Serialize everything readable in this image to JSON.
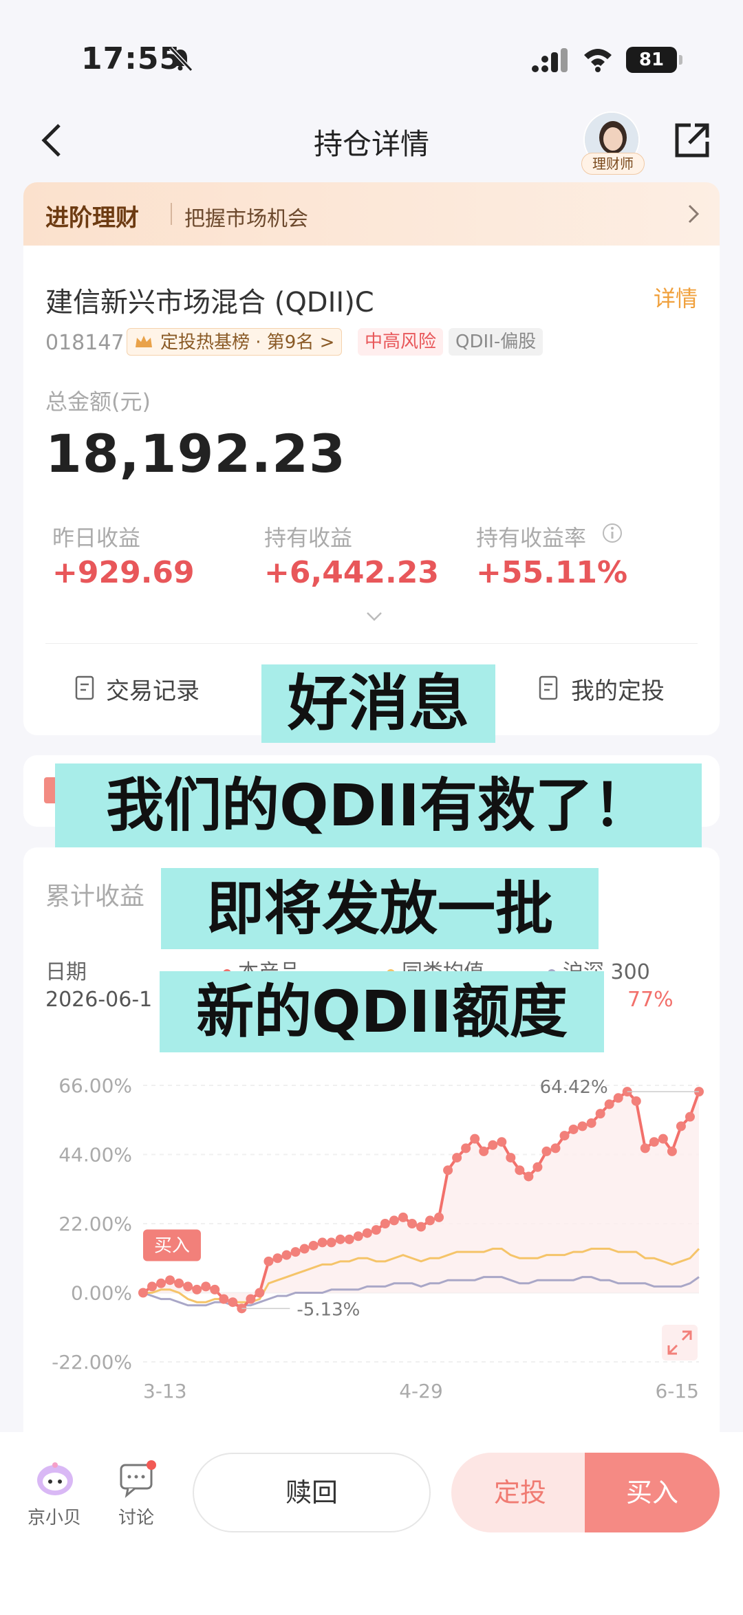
{
  "status": {
    "time": "17:55",
    "battery": "81"
  },
  "nav": {
    "title": "持仓详情",
    "advisor_badge": "理财师"
  },
  "banner": {
    "title": "进阶理财",
    "subtitle": "把握市场机会"
  },
  "fund": {
    "name": "建信新兴市场混合 (QDII)C",
    "detail": "详情",
    "code": "018147",
    "tags": [
      "定投热基榜 · 第9名 >",
      "中高风险",
      "QDII-偏股"
    ],
    "total_label": "总金额(元)",
    "total": "18,192.23",
    "stats": [
      {
        "label": "昨日收益",
        "value": "+929.69"
      },
      {
        "label": "持有收益",
        "value": "+6,442.23"
      },
      {
        "label": "持有收益率",
        "value": "+55.11%"
      }
    ],
    "actions": [
      "交易记录",
      "我的定投"
    ]
  },
  "chart_section": {
    "title": "累计收益",
    "date_label": "日期",
    "date_value": "2026-06-1",
    "legend": [
      "本产品",
      "同类均值",
      "沪深 300"
    ],
    "visible_value": "77%",
    "buy_marker": "买入"
  },
  "chart_data": {
    "type": "line",
    "x_ticks": [
      "3-13",
      "4-29",
      "6-15"
    ],
    "y_ticks": [
      "66.00%",
      "44.00%",
      "22.00%",
      "0.00%",
      "-22.00%"
    ],
    "ylim": [
      -22,
      66
    ],
    "annotations": [
      "64.42%",
      "-5.13%"
    ],
    "series": [
      {
        "name": "本产品",
        "color": "#f2706b",
        "values": [
          0,
          2,
          3,
          4,
          3,
          2,
          1,
          2,
          1,
          -2,
          -3,
          -5,
          -2,
          0,
          10,
          11,
          12,
          13,
          14,
          15,
          16,
          16,
          17,
          17,
          18,
          19,
          20,
          22,
          23,
          24,
          22,
          21,
          23,
          24,
          39,
          43,
          46,
          49,
          45,
          47,
          48,
          43,
          39,
          37,
          40,
          45,
          46,
          50,
          52,
          53,
          54,
          57,
          60,
          62,
          64,
          61,
          46,
          48,
          49,
          45,
          53,
          56,
          64
        ]
      },
      {
        "name": "同类均值",
        "color": "#f5c469",
        "values": [
          0,
          0,
          1,
          1,
          0,
          -2,
          -3,
          -3,
          -2,
          -2,
          -3,
          -3,
          -3,
          -2,
          3,
          4,
          5,
          6,
          7,
          8,
          9,
          9,
          10,
          10,
          11,
          11,
          10,
          10,
          11,
          12,
          11,
          10,
          11,
          11,
          12,
          13,
          13,
          13,
          13,
          14,
          14,
          12,
          11,
          11,
          11,
          12,
          12,
          12,
          13,
          13,
          14,
          14,
          14,
          13,
          13,
          13,
          11,
          11,
          10,
          9,
          10,
          11,
          14
        ]
      },
      {
        "name": "沪深 300",
        "color": "#a9a7c7",
        "values": [
          0,
          -1,
          -2,
          -2,
          -3,
          -4,
          -4,
          -4,
          -3,
          -3,
          -4,
          -4,
          -4,
          -3,
          -2,
          -1,
          -1,
          0,
          0,
          0,
          0,
          1,
          1,
          1,
          1,
          2,
          2,
          2,
          3,
          3,
          3,
          2,
          3,
          3,
          4,
          4,
          4,
          4,
          5,
          5,
          5,
          4,
          3,
          3,
          4,
          4,
          4,
          4,
          4,
          5,
          5,
          4,
          4,
          3,
          3,
          3,
          3,
          2,
          2,
          2,
          2,
          3,
          5
        ]
      }
    ]
  },
  "captions": [
    "好消息",
    "我们的QDII有救了！",
    "即将发放一批",
    "新的QDII额度"
  ],
  "bottom": {
    "items": [
      "京小贝",
      "讨论"
    ],
    "redeem": "赎回",
    "sip": "定投",
    "buy": "买入"
  }
}
